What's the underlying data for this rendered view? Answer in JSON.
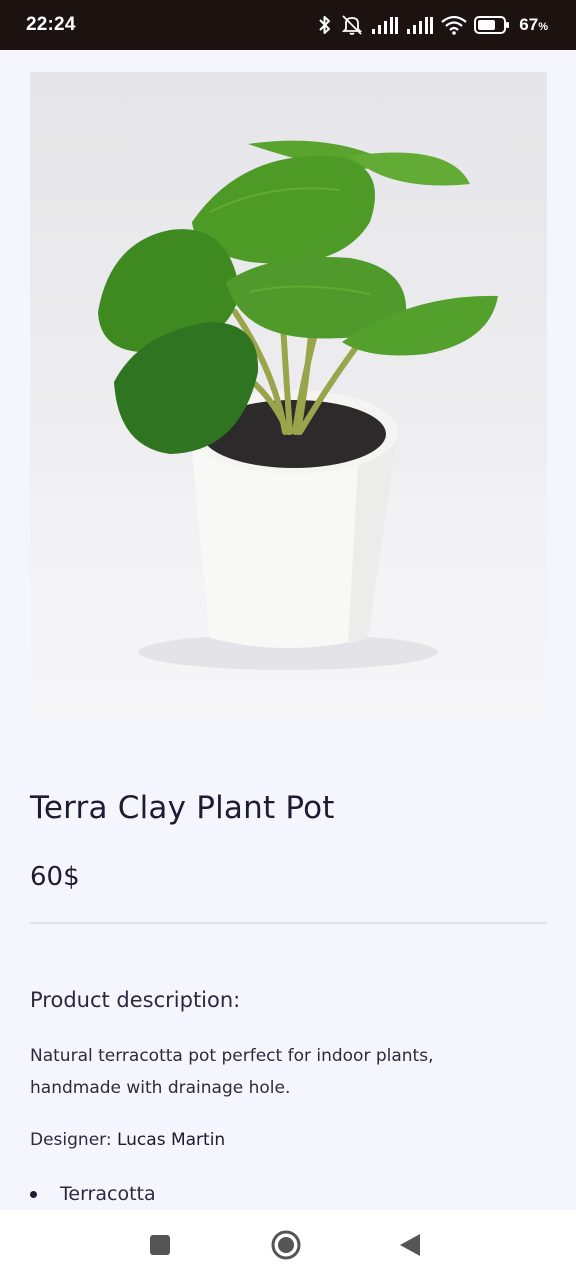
{
  "status_bar": {
    "time": "22:24",
    "battery_percent": "67",
    "battery_unit": "%",
    "icons": [
      "bluetooth-icon",
      "muted-bell-icon",
      "signal-icon",
      "signal-icon",
      "wifi-icon",
      "battery-icon"
    ]
  },
  "product": {
    "image_alt": "Green plant in white pot",
    "title": "Terra Clay Plant Pot",
    "price": "60$",
    "description_heading": "Product description:",
    "description": "Natural terracotta pot perfect for indoor plants, handmade with drainage hole.",
    "designer_label": "Designer:",
    "designer_name": "Lucas Martin",
    "features": [
      "Terracotta"
    ]
  },
  "nav_bar": {
    "buttons": [
      "recents-icon",
      "home-icon",
      "back-icon"
    ]
  },
  "colors": {
    "status_bar_bg": "#1c1210",
    "page_bg": "#f5f6fd",
    "text": "#1f1b32",
    "leaf": "#4f9a2a"
  }
}
